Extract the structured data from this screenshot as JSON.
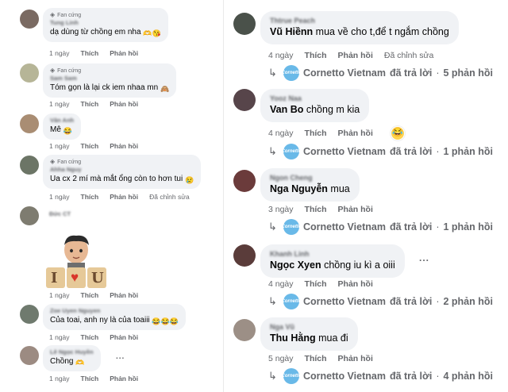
{
  "left": {
    "comments": [
      {
        "badge": "Fan cứng",
        "name": "Tung Linh",
        "text": "dạ dùng từ chồng em nha",
        "emoji": "🫶😘",
        "time": "1 ngày",
        "like": "Thích",
        "reply": "Phản hồi",
        "edited": ""
      },
      {
        "badge": "Fan cứng",
        "name": "Sam Sam",
        "text": "Tóm gọn là lại ck iem nhaa mn",
        "emoji": "🙈",
        "time": "1 ngày",
        "like": "Thích",
        "reply": "Phản hồi",
        "edited": ""
      },
      {
        "badge": "",
        "name": "Văn Anh",
        "text": "Mê",
        "emoji": "😂",
        "time": "1 ngày",
        "like": "Thích",
        "reply": "Phản hồi",
        "edited": ""
      },
      {
        "badge": "Fan cứng",
        "name": "Ahha Nguy",
        "text": "Ua cx 2 mí mà mắt ổng còn to hơn tui",
        "emoji": "😢",
        "time": "1 ngày",
        "like": "Thích",
        "reply": "Phản hồi",
        "edited": "Đã chỉnh sửa"
      },
      {
        "badge": "",
        "name": "Đức CT",
        "text": "",
        "emoji": "",
        "time": "",
        "like": "",
        "reply": "",
        "edited": ""
      },
      {
        "badge": "",
        "name": "Zoe Uyen Nguyen",
        "text": "Của toai, anh ny là của toaiii",
        "emoji": "😂😂😂",
        "time": "1 ngày",
        "like": "Thích",
        "reply": "Phản hồi",
        "edited": ""
      },
      {
        "badge": "",
        "name": "Lê Ngọc Huyền",
        "text": "Chồng",
        "emoji": "🫶",
        "time": "1 ngày",
        "like": "Thích",
        "reply": "Phản hồi",
        "edited": ""
      }
    ],
    "sticker": {
      "letters": [
        "I",
        "♥",
        "U"
      ],
      "first_time": "1 ngày",
      "first_like": "Thích",
      "first_reply": "Phản hồi"
    }
  },
  "right": {
    "brand": "Cornetto Vietnam",
    "brand_short": "Cornetto",
    "replied_text": "đã trả lời",
    "comments": [
      {
        "name": "Thtrue Peach",
        "author": "Vũ Hiềnn",
        "text": "mua về cho t,để t ngắm chồng",
        "time": "4 ngày",
        "like": "Thích",
        "reply": "Phản hồi",
        "edited": "Đã chỉnh sửa",
        "replies": "5 phản hồi"
      },
      {
        "name": "Yooz Naa",
        "author": "Van Bo",
        "text": "chồng m kia",
        "time": "4 ngày",
        "like": "Thích",
        "reply": "Phản hồi",
        "edited": "",
        "replies": "1 phản hồi",
        "reaction": "😂"
      },
      {
        "name": "Ngon Cheng",
        "author": "Nga Nguyễn",
        "text": "mua",
        "time": "3 ngày",
        "like": "Thích",
        "reply": "Phản hồi",
        "edited": "",
        "replies": "1 phản hồi"
      },
      {
        "name": "Khanh Linh",
        "author": "Ngọc Xyen",
        "text": "chồng iu kì a oiii",
        "time": "4 ngày",
        "like": "Thích",
        "reply": "Phản hồi",
        "edited": "",
        "replies": "2 phản hồi"
      },
      {
        "name": "Nga Vũ",
        "author": "Thu Hằng",
        "text": "mua đi",
        "time": "5 ngày",
        "like": "Thích",
        "reply": "Phản hồi",
        "edited": "",
        "replies": "4 phản hồi"
      }
    ],
    "more_label": "..."
  }
}
